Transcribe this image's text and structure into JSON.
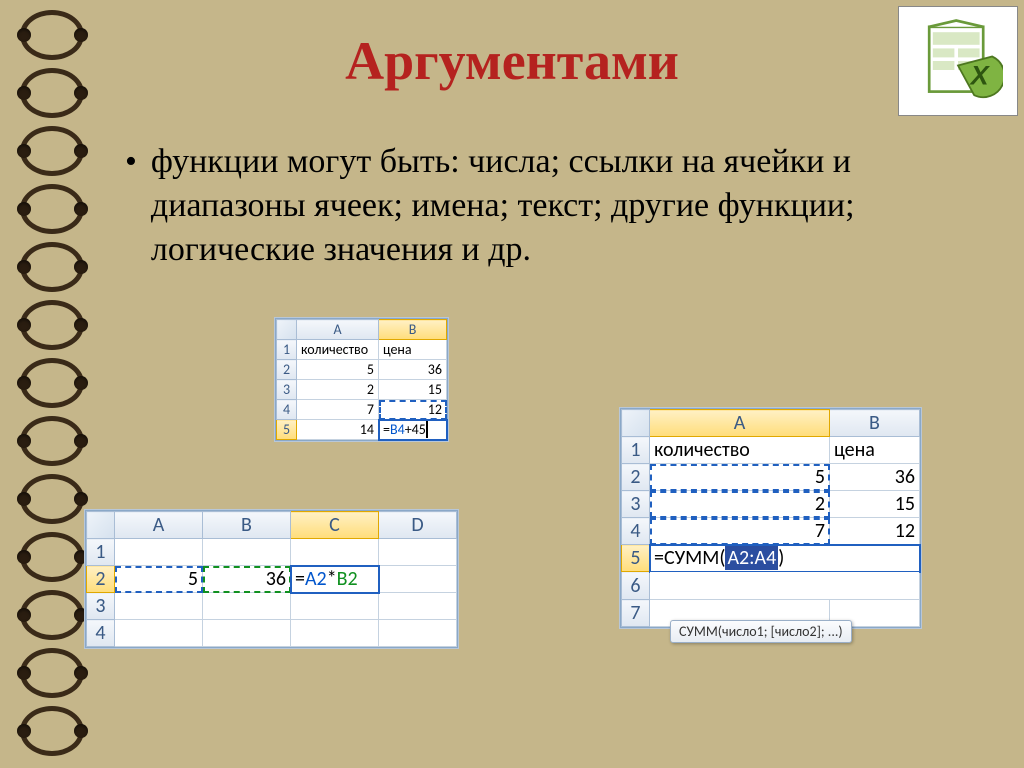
{
  "title": "Аргументами",
  "body": "функции могут быть: числа; ссылки на ячейки и диапазоны ячеек; имена; текст; другие функции; логические значения и др.",
  "table1": {
    "cols": [
      "A",
      "B"
    ],
    "rows": [
      "1",
      "2",
      "3",
      "4",
      "5"
    ],
    "data": {
      "r1a": "количество",
      "r1b": "цена",
      "r2a": "5",
      "r2b": "36",
      "r3a": "2",
      "r3b": "15",
      "r4a": "7",
      "r4b": "12",
      "r5a": "14"
    },
    "formula_prefix": "=",
    "formula_ref": "B4",
    "formula_suffix": "+45"
  },
  "table2": {
    "cols": [
      "A",
      "B",
      "C",
      "D"
    ],
    "rows": [
      "1",
      "2",
      "3",
      "4"
    ],
    "data": {
      "r2a": "5",
      "r2b": "36"
    },
    "formula_prefix": "=",
    "formula_part1": "A2",
    "formula_op": "*",
    "formula_part2": "B2"
  },
  "table3": {
    "cols": [
      "A",
      "B"
    ],
    "rows": [
      "1",
      "2",
      "3",
      "4",
      "5",
      "6",
      "7"
    ],
    "data": {
      "r1a": "количество",
      "r1b": "цена",
      "r2a": "5",
      "r2b": "36",
      "r3a": "2",
      "r3b": "15",
      "r4a": "7",
      "r4b": "12"
    },
    "formula_prefix": "=СУММ(",
    "formula_range": "A2:A4",
    "formula_suffix": ")",
    "tooltip": "СУММ(число1; [число2]; ...)"
  }
}
